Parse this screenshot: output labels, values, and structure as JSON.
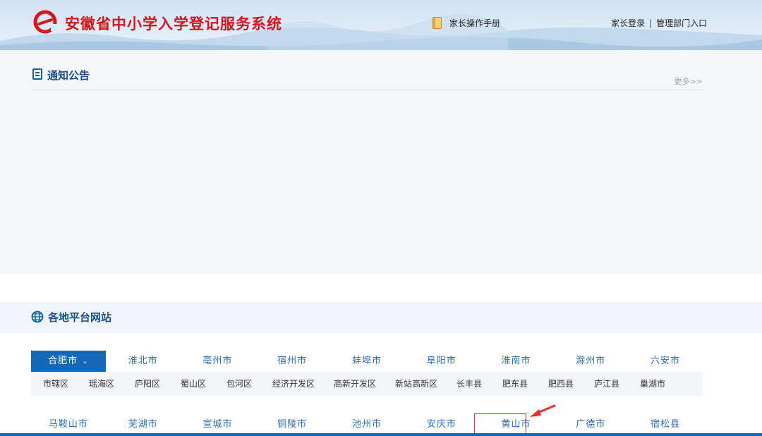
{
  "header": {
    "site_title": "安徽省中小学入学登记服务系统",
    "manual_label": "家长操作手册",
    "parent_login": "家长登录",
    "separator": "|",
    "admin_entry": "管理部门入口"
  },
  "notice": {
    "title": "通知公告",
    "more": "更多>>"
  },
  "regions": {
    "title": "各地平台网站",
    "row1": [
      "合肥市",
      "淮北市",
      "亳州市",
      "宿州市",
      "蚌埠市",
      "阜阳市",
      "淮南市",
      "滁州市",
      "六安市"
    ],
    "active_chevron": "⌄",
    "districts": [
      "市辖区",
      "瑶海区",
      "庐阳区",
      "蜀山区",
      "包河区",
      "经济开发区",
      "高新开发区",
      "新站高新区",
      "长丰县",
      "肥东县",
      "肥西县",
      "庐江县",
      "巢湖市"
    ],
    "row2": [
      "马鞍山市",
      "芜湖市",
      "宣城市",
      "铜陵市",
      "池州市",
      "安庆市",
      "黄山市",
      "广德市",
      "宿松县"
    ]
  },
  "colors": {
    "brand_red": "#d8141d",
    "primary_blue": "#1568b7",
    "link_blue": "#2d6db5",
    "highlight_red": "#e0322c"
  },
  "icons": {
    "logo": "e-logo-icon",
    "manual": "book-icon",
    "notice": "notice-icon",
    "regions": "globe-icon",
    "annotation": "arrow-icon"
  }
}
